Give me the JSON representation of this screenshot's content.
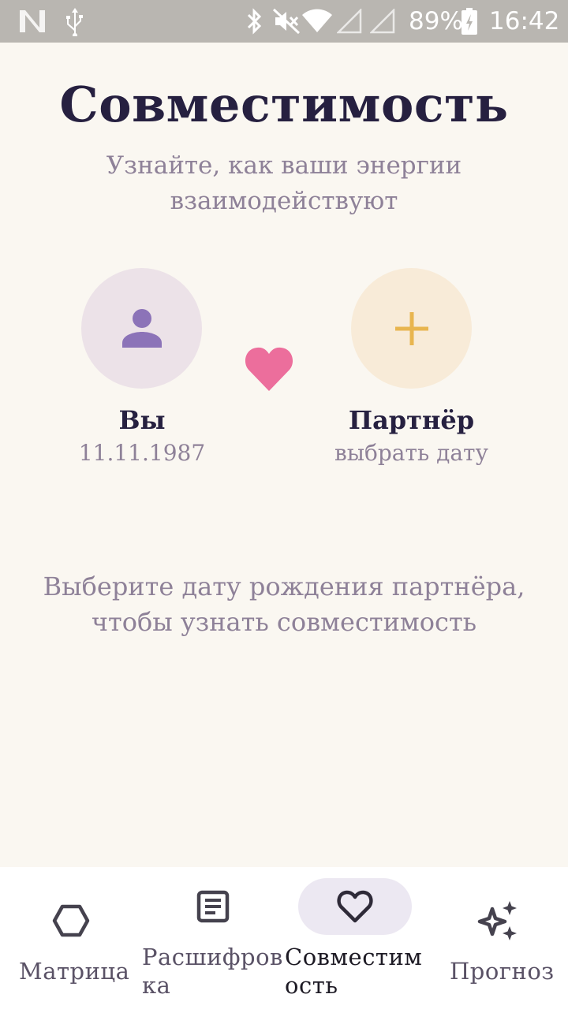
{
  "status_bar": {
    "battery": "89%",
    "time": "16:42"
  },
  "page": {
    "title": "Совместимость",
    "subtitle": "Узнайте, как ваши энергии взаимодействуют"
  },
  "you": {
    "name": "Вы",
    "date": "11.11.1987",
    "icon": "person-icon"
  },
  "partner": {
    "name": "Партнёр",
    "date_prompt": "выбрать дату",
    "icon": "plus-icon"
  },
  "hint": "Выберите дату рождения партнёра, чтобы узнать совместимость",
  "colors": {
    "background": "#faf7f1",
    "title": "#262040",
    "muted": "#8e8198",
    "accent_purple": "#8c73b8",
    "accent_gold": "#e8b54f",
    "heart": "#ec6e9c"
  },
  "nav": {
    "items": [
      {
        "label": "Матрица",
        "icon": "hexagon-icon",
        "active": false
      },
      {
        "label": "Расшифровка",
        "icon": "document-icon",
        "active": false
      },
      {
        "label": "Совместимость",
        "icon": "heart-outline-icon",
        "active": true
      },
      {
        "label": "Прогноз",
        "icon": "sparkles-icon",
        "active": false
      }
    ]
  }
}
